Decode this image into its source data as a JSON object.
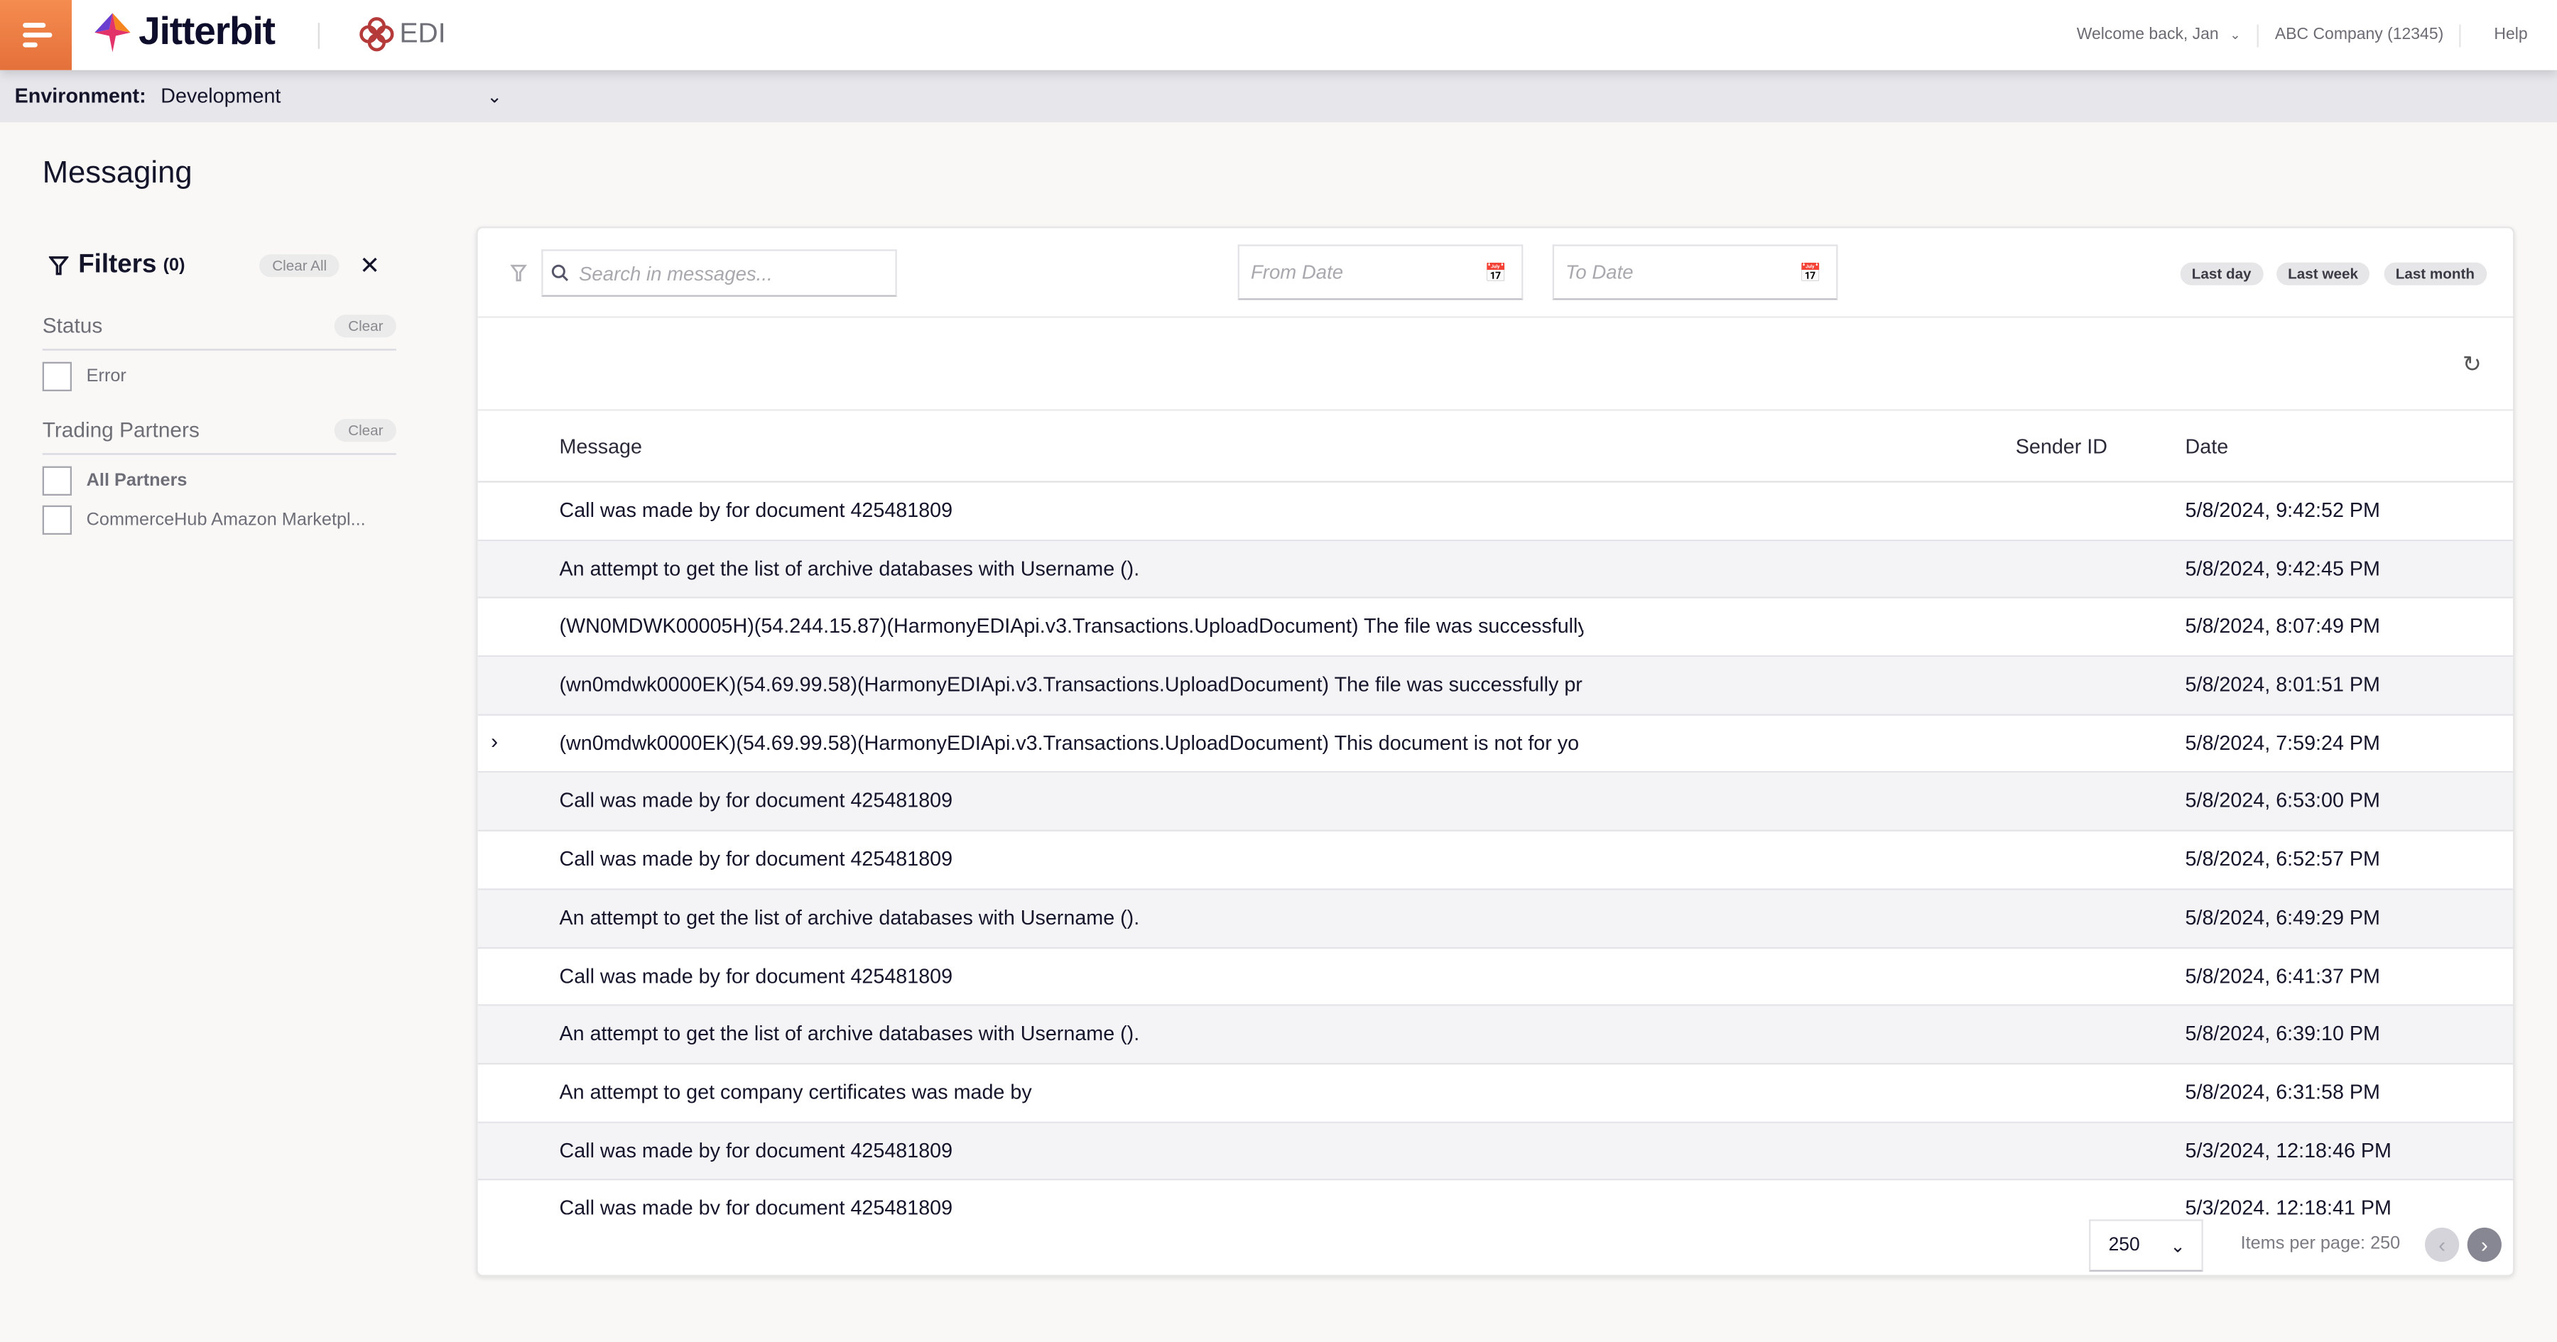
{
  "header": {
    "brand": "Jitterbit",
    "product": "EDI",
    "welcome": "Welcome back, Jan",
    "company": "ABC Company (12345)",
    "help": "Help",
    "accent": "#f0803f"
  },
  "environment": {
    "label": "Environment:",
    "value": "Development"
  },
  "page": {
    "title": "Messaging"
  },
  "filters": {
    "title": "Filters",
    "count": "(0)",
    "clear_all": "Clear All",
    "sections": [
      {
        "title": "Status",
        "clear": "Clear",
        "options": [
          "Error"
        ]
      },
      {
        "title": "Trading Partners",
        "clear": "Clear",
        "options": [
          "All Partners",
          "CommerceHub Amazon Marketpl..."
        ]
      }
    ]
  },
  "toolbar": {
    "search_placeholder": "Search in messages...",
    "from_placeholder": "From Date",
    "to_placeholder": "To Date",
    "quick": [
      "Last day",
      "Last week",
      "Last month"
    ]
  },
  "table": {
    "columns": [
      "Message",
      "Sender ID",
      "Date"
    ],
    "rows": [
      {
        "message": "Call was made by for document 425481809",
        "sender": "",
        "date": "5/8/2024, 9:42:52 PM"
      },
      {
        "message": "An attempt to get the list of archive databases with Username ().",
        "sender": "",
        "date": "5/8/2024, 9:42:45 PM"
      },
      {
        "message": "(WN0MDWK00005H)(54.244.15.87)(HarmonyEDIApi.v3.Transactions.UploadDocument) The file was successfully",
        "sender": "",
        "date": "5/8/2024, 8:07:49 PM"
      },
      {
        "message": "(wn0mdwk0000EK)(54.69.99.58)(HarmonyEDIApi.v3.Transactions.UploadDocument) The file was successfully pr",
        "sender": "",
        "date": "5/8/2024, 8:01:51 PM"
      },
      {
        "message": "(wn0mdwk0000EK)(54.69.99.58)(HarmonyEDIApi.v3.Transactions.UploadDocument) This document is not for yo",
        "sender": "",
        "date": "5/8/2024, 7:59:24 PM",
        "expandable": true
      },
      {
        "message": "Call was made by for document 425481809",
        "sender": "",
        "date": "5/8/2024, 6:53:00 PM"
      },
      {
        "message": "Call was made by for document 425481809",
        "sender": "",
        "date": "5/8/2024, 6:52:57 PM"
      },
      {
        "message": "An attempt to get the list of archive databases with Username ().",
        "sender": "",
        "date": "5/8/2024, 6:49:29 PM"
      },
      {
        "message": "Call was made by for document 425481809",
        "sender": "",
        "date": "5/8/2024, 6:41:37 PM"
      },
      {
        "message": "An attempt to get the list of archive databases with Username ().",
        "sender": "",
        "date": "5/8/2024, 6:39:10 PM"
      },
      {
        "message": "An attempt to get company certificates was made by",
        "sender": "",
        "date": "5/8/2024, 6:31:58 PM"
      },
      {
        "message": "Call was made by for document 425481809",
        "sender": "",
        "date": "5/3/2024, 12:18:46 PM"
      },
      {
        "message": "Call was made by for document 425481809",
        "sender": "",
        "date": "5/3/2024, 12:18:41 PM"
      }
    ]
  },
  "pagination": {
    "page_size": "250",
    "items_per_page": "Items per page: 250"
  }
}
